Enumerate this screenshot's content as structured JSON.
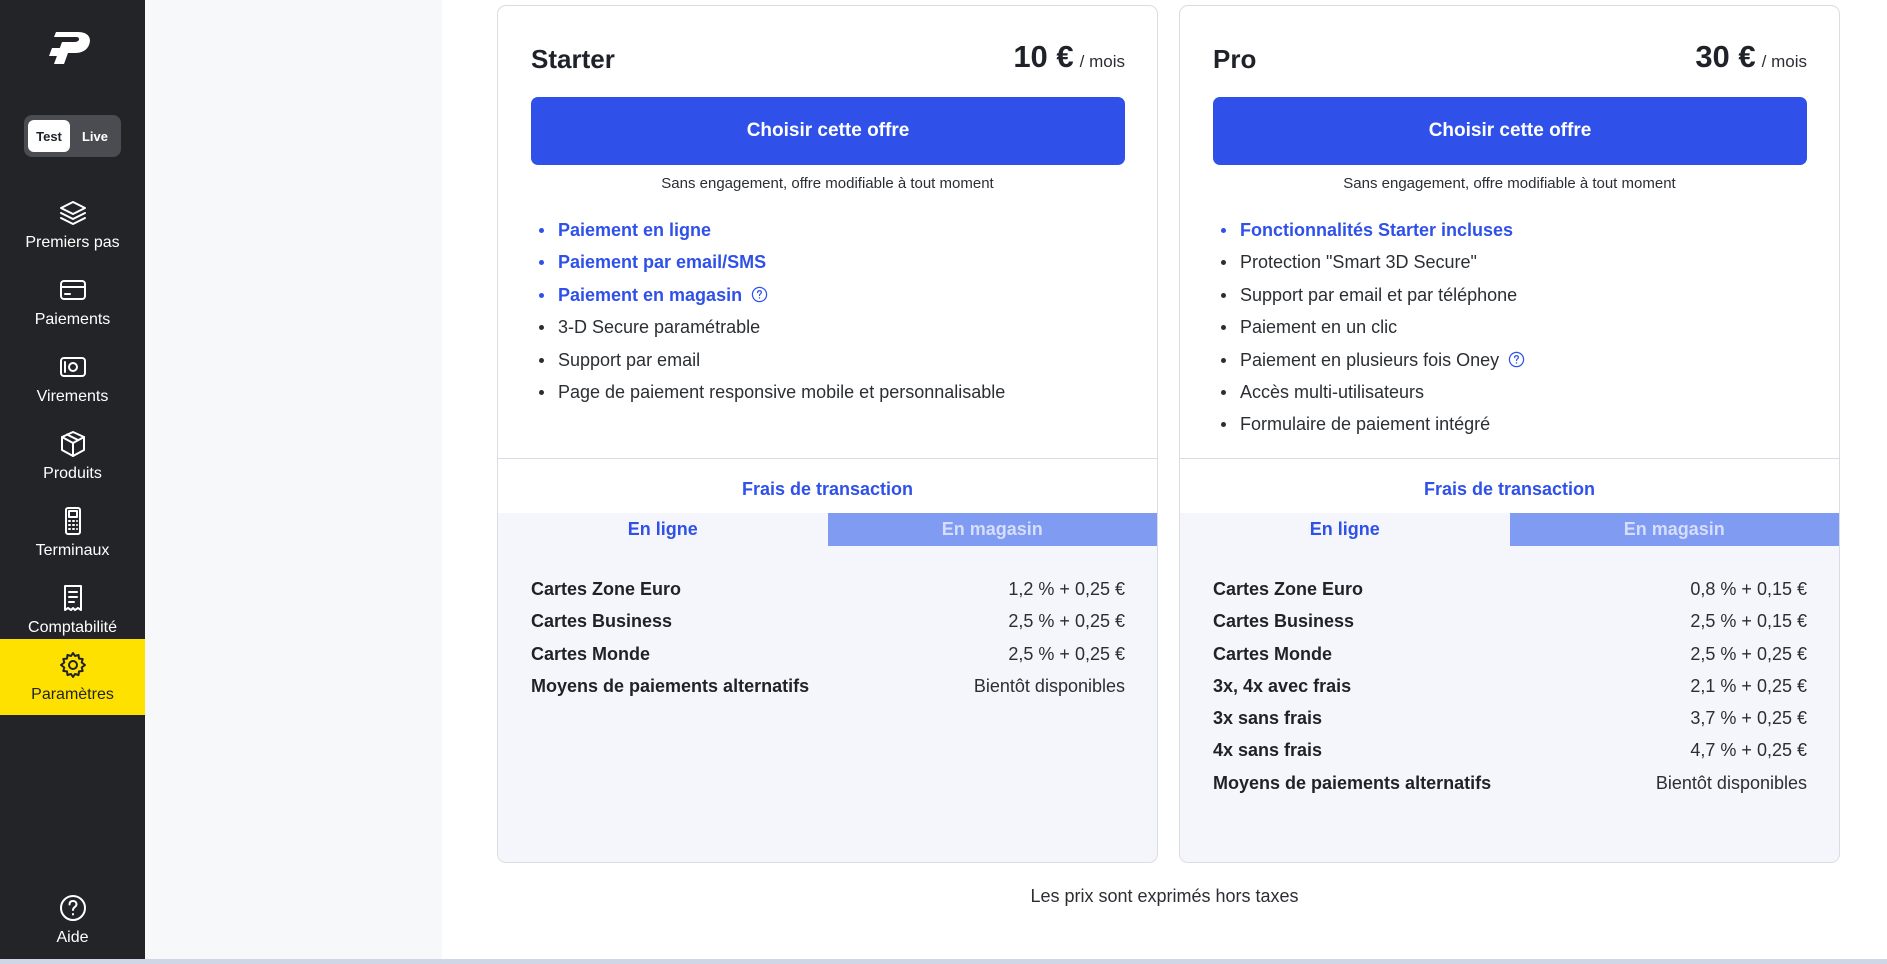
{
  "sidebar": {
    "mode": {
      "test": "Test",
      "live": "Live",
      "selected": "Test"
    },
    "items": [
      {
        "label": "Premiers pas",
        "icon": "layers-icon"
      },
      {
        "label": "Paiements",
        "icon": "card-icon"
      },
      {
        "label": "Virements",
        "icon": "banknote-icon"
      },
      {
        "label": "Produits",
        "icon": "box-icon"
      },
      {
        "label": "Terminaux",
        "icon": "terminal-icon"
      },
      {
        "label": "Comptabilité",
        "icon": "receipt-icon"
      },
      {
        "label": "Paramètres",
        "icon": "gear-icon",
        "active": true
      }
    ],
    "help": {
      "label": "Aide",
      "icon": "help-circle-icon"
    }
  },
  "plans": [
    {
      "name": "Starter",
      "price": "10 €",
      "period": "/ mois",
      "cta": "Choisir cette offre",
      "engagement": "Sans engagement, offre modifiable à tout moment",
      "features": [
        {
          "text": "Paiement en ligne",
          "highlight": true
        },
        {
          "text": "Paiement par email/SMS",
          "highlight": true
        },
        {
          "text": "Paiement en magasin",
          "highlight": true,
          "help": true
        },
        {
          "text": "3-D Secure paramétrable"
        },
        {
          "text": "Support par email"
        },
        {
          "text": "Page de paiement responsive mobile et personnalisable"
        }
      ],
      "fees_title": "Frais de transaction",
      "tabs": [
        "En ligne",
        "En magasin"
      ],
      "active_tab": "En ligne",
      "fees": [
        {
          "label": "Cartes Zone Euro",
          "value": "1,2 % + 0,25 €"
        },
        {
          "label": "Cartes Business",
          "value": "2,5 % + 0,25 €"
        },
        {
          "label": "Cartes Monde",
          "value": "2,5 % + 0,25 €"
        },
        {
          "label": "Moyens de paiements alternatifs",
          "value": "Bientôt disponibles"
        }
      ]
    },
    {
      "name": "Pro",
      "price": "30 €",
      "period": "/ mois",
      "cta": "Choisir cette offre",
      "engagement": "Sans engagement, offre modifiable à tout moment",
      "features": [
        {
          "text": "Fonctionnalités Starter incluses",
          "highlight": true
        },
        {
          "text": "Protection \"Smart 3D Secure\""
        },
        {
          "text": "Support par email et par téléphone"
        },
        {
          "text": "Paiement en un clic"
        },
        {
          "text": "Paiement en plusieurs fois Oney",
          "help": true
        },
        {
          "text": "Accès multi-utilisateurs"
        },
        {
          "text": "Formulaire de paiement intégré"
        }
      ],
      "fees_title": "Frais de transaction",
      "tabs": [
        "En ligne",
        "En magasin"
      ],
      "active_tab": "En ligne",
      "fees": [
        {
          "label": "Cartes Zone Euro",
          "value": "0,8 % + 0,15 €"
        },
        {
          "label": "Cartes Business",
          "value": "2,5 % + 0,15 €"
        },
        {
          "label": "Cartes Monde",
          "value": "2,5 % + 0,25 €"
        },
        {
          "label": "3x, 4x avec frais",
          "value": "2,1 % + 0,25 €"
        },
        {
          "label": "3x sans frais",
          "value": "3,7 % + 0,25 €"
        },
        {
          "label": "4x sans frais",
          "value": "4,7 % + 0,25 €"
        },
        {
          "label": "Moyens de paiements alternatifs",
          "value": "Bientôt disponibles"
        }
      ]
    }
  ],
  "footnote": "Les prix sont exprimés hors taxes",
  "colors": {
    "sidebar": "#232427",
    "active": "#ffe100",
    "primary": "#2f51ea",
    "tab_inactive": "#7f9bf2"
  }
}
